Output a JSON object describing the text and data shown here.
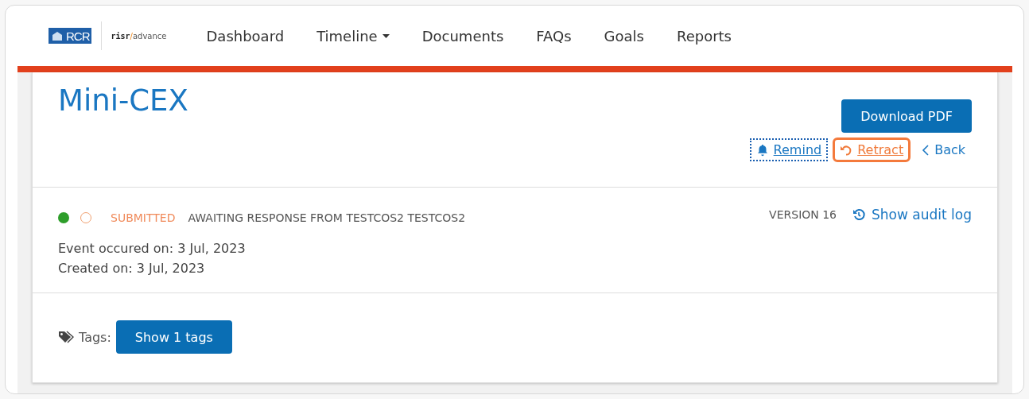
{
  "logo": {
    "mark": "RCR",
    "brand": "risr",
    "slash": "/",
    "product": "advance"
  },
  "nav": [
    {
      "label": "Dashboard",
      "dropdown": false
    },
    {
      "label": "Timeline",
      "dropdown": true
    },
    {
      "label": "Documents",
      "dropdown": false
    },
    {
      "label": "FAQs",
      "dropdown": false
    },
    {
      "label": "Goals",
      "dropdown": false
    },
    {
      "label": "Reports",
      "dropdown": false
    }
  ],
  "title": "Mini-CEX",
  "download_button": "Download PDF",
  "actions": [
    {
      "label": "Remind",
      "kind": "remind",
      "focused": true,
      "highlighted": false
    },
    {
      "label": "Retract",
      "kind": "retract",
      "focused": false,
      "highlighted": true
    },
    {
      "label": "Back",
      "kind": "back",
      "focused": false,
      "highlighted": false
    }
  ],
  "status": {
    "dots": [
      {
        "kind": "filled",
        "color": "#2e9e2a"
      },
      {
        "kind": "outline",
        "color": "#f0a070"
      }
    ],
    "state": "SUBMITTED",
    "message": "AWAITING RESPONSE FROM TESTCOS2 TESTCOS2"
  },
  "version": "VERSION 16",
  "audit_link": "Show audit log",
  "dates": [
    "Event occured on: 3 Jul, 2023",
    "Created on: 3 Jul, 2023"
  ],
  "tags": {
    "label": "Tags:",
    "button": "Show 1 tags"
  }
}
